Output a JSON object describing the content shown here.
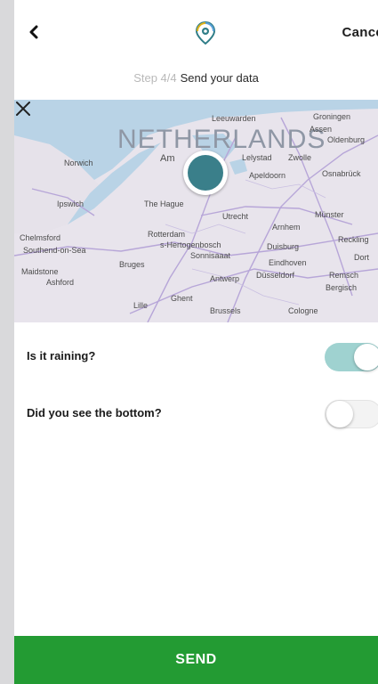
{
  "header": {
    "back_icon": "chevron-left-icon",
    "logo_icon": "location-pin-logo",
    "cancel_label": "Cance"
  },
  "step": {
    "count": "Step 4/4",
    "title": "Send your data"
  },
  "map": {
    "country_label": "NETHERLANDS",
    "places": [
      "Leeuwarden",
      "Groningen",
      "Assen",
      "Oldenburg",
      "Norwich",
      "Am",
      "Lelystad",
      "Zwolle",
      "Apeldoorn",
      "Osnabrück",
      "Ipswich",
      "The Hague",
      "Utrecht",
      "Arnhem",
      "Münster",
      "Chelmsford",
      "Rotterdam",
      "s-Hertogenbosch",
      "Duisburg",
      "Reckling",
      "Southend-on-Sea",
      "Bruges",
      "Sonnisaaat",
      "Eindhoven",
      "Dort",
      "Maidstone",
      "Ashford",
      "Antwerp",
      "Düsseldorf",
      "Remsch",
      "Bergisch",
      "Ghent",
      "Lille",
      "Brussels",
      "Cologne"
    ],
    "marker_color": "#3a7f8a"
  },
  "questions": [
    {
      "label": "Is it raining?",
      "value": true
    },
    {
      "label": "Did you see the bottom?",
      "value": false
    }
  ],
  "send_label": "SEND",
  "colors": {
    "accent_green": "#239b33",
    "toggle_on": "#9fd2d0",
    "marker": "#3a7f8a"
  }
}
